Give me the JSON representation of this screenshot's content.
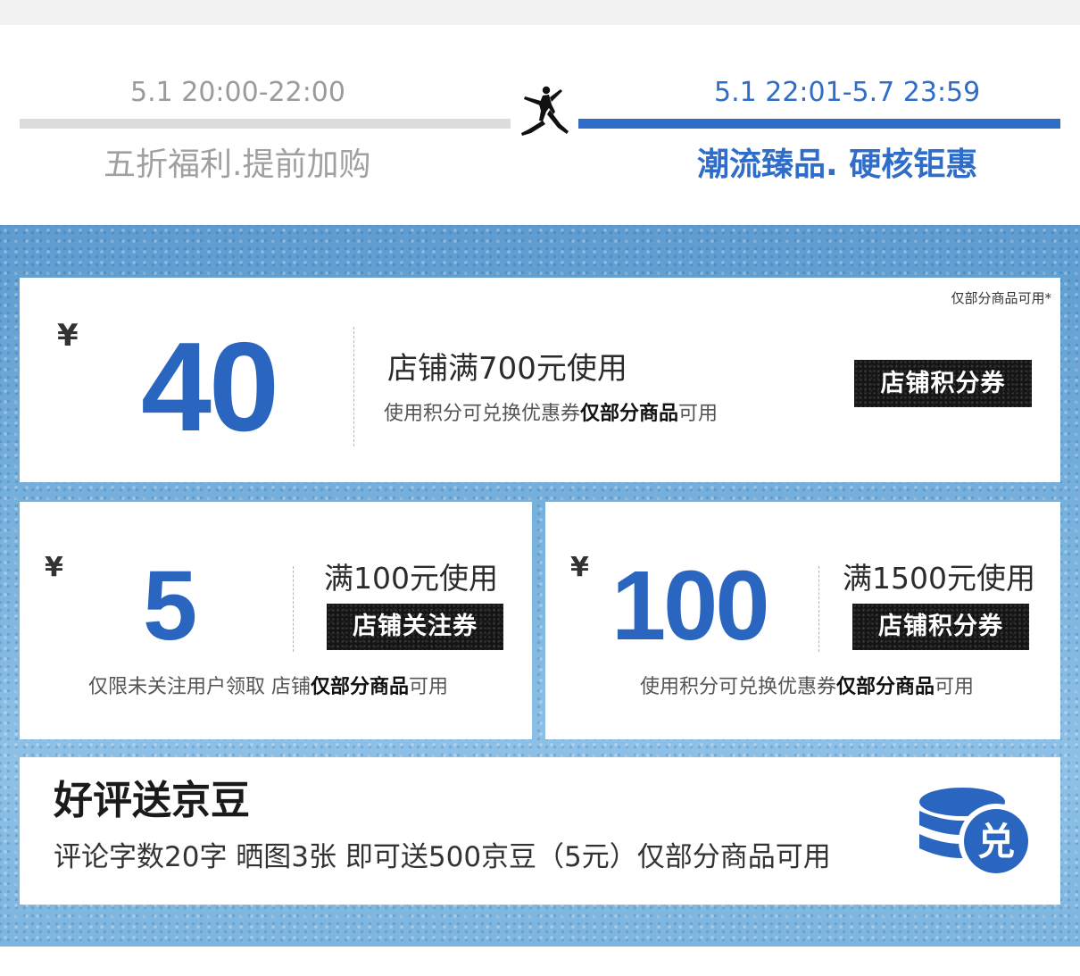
{
  "timeline": {
    "phase1": {
      "date": "5.1 20:00-22:00",
      "title": "五折福利.提前加购"
    },
    "phase2": {
      "date": "5.1 22:01-5.7 23:59",
      "title": "潮流臻品. 硬核钜惠"
    }
  },
  "colors": {
    "accent_blue": "#2f6dc9",
    "amount_blue": "#2a66bf",
    "inactive_gray": "#9b9b9b",
    "tag_black": "#141414",
    "panel_blue": "#6fa9d6"
  },
  "icons": {
    "brand": "jumpman-logo-icon",
    "exchange": "jingdou-coin-exchange-icon"
  },
  "coupons": [
    {
      "currency": "¥",
      "amount": "40",
      "condition": "店铺满700元使用",
      "note_prefix": "使用积分可兑换优惠券",
      "note_bold": "仅部分商品",
      "note_suffix": "可用",
      "badge": "店铺积分券",
      "corner_note": "仅部分商品可用*"
    },
    {
      "currency": "¥",
      "amount": "5",
      "condition": "满100元使用",
      "badge": "店铺关注券",
      "note_prefix": "仅限未关注用户领取 店铺",
      "note_bold": "仅部分商品",
      "note_suffix": "可用"
    },
    {
      "currency": "¥",
      "amount": "100",
      "condition": "满1500元使用",
      "badge": "店铺积分券",
      "note_prefix": "使用积分可兑换优惠券",
      "note_bold": "仅部分商品",
      "note_suffix": "可用"
    }
  ],
  "review_reward": {
    "title": "好评送京豆",
    "description": "评论字数20字 晒图3张 即可送500京豆（5元）仅部分商品可用",
    "icon_label": "兑"
  }
}
